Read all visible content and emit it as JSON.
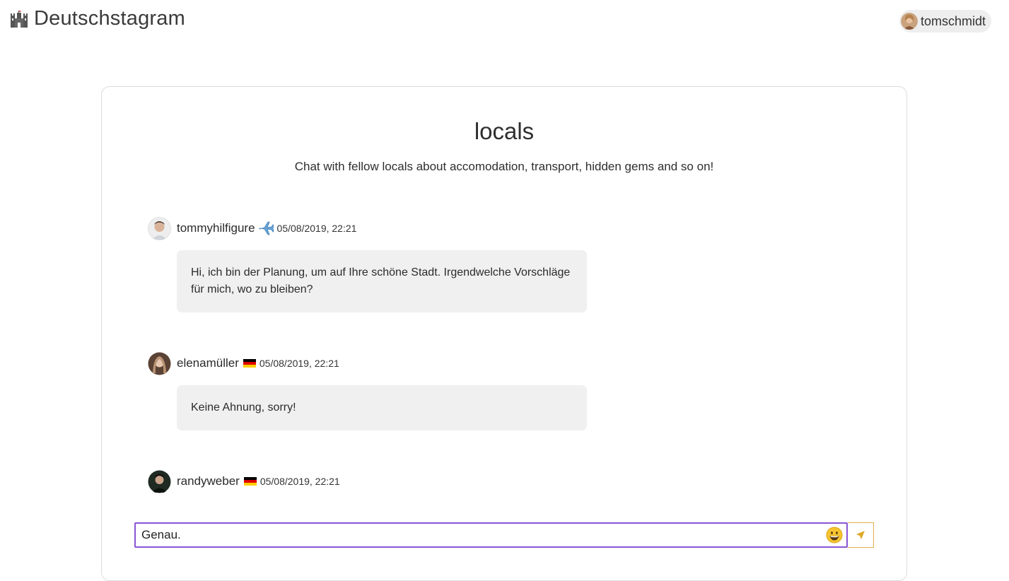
{
  "header": {
    "brand_icon": "castle-icon",
    "brand_name": "Deutschstagram",
    "user": {
      "name": "tomschmidt",
      "avatar": "avatar"
    }
  },
  "room": {
    "title": "locals",
    "description": "Chat with fellow locals about accomodation, transport, hidden gems and so on!"
  },
  "messages": [
    {
      "author": "tommyhilfigure",
      "badge": "airplane-icon",
      "timestamp": "05/08/2019, 22:21",
      "text": "Hi, ich bin der Planung, um auf Ihre schöne Stadt. Irgendwelche Vorschläge für mich, wo zu bleiben?"
    },
    {
      "author": "elenamüller",
      "badge": "germany-flag-icon",
      "timestamp": "05/08/2019, 22:21",
      "text": "Keine Ahnung, sorry!"
    },
    {
      "author": "randyweber",
      "badge": "germany-flag-icon",
      "timestamp": "05/08/2019, 22:21",
      "text": ""
    }
  ],
  "composer": {
    "value": "Genau.",
    "emoji_icon": "grinning-face-icon",
    "send_icon": "paper-plane-icon"
  },
  "colors": {
    "input_border": "#8a55d4",
    "send_border": "#e0b04a",
    "bubble_bg": "#f0f0f0",
    "flag_black": "#000000",
    "flag_red": "#dd0000",
    "flag_gold": "#ffce00"
  }
}
